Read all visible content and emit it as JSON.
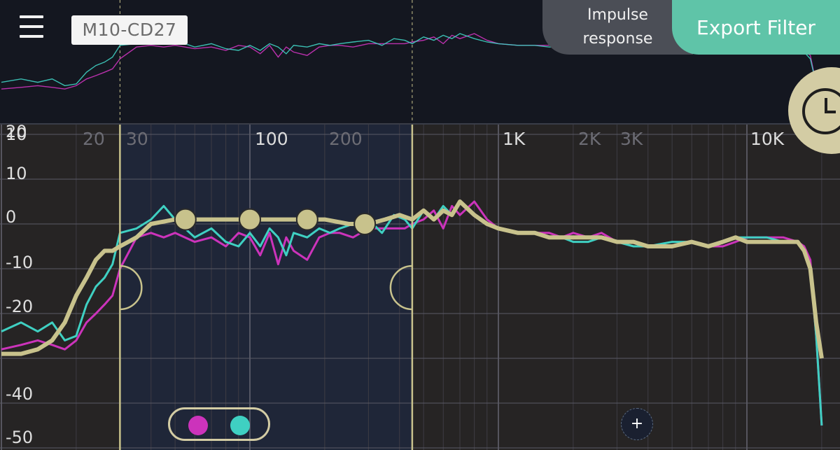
{
  "header": {
    "device_label": "M10-CD27",
    "tab_impulse": "Impulse\nresponse",
    "tab_impulse_line1": "Impulse",
    "tab_impulse_line2": "response",
    "tab_export": "Export Filter"
  },
  "colors": {
    "left_channel": "#cc33bb",
    "right_channel": "#3fd0c2",
    "target_curve": "#c8c28c",
    "selection_fill": "#1f2638",
    "accent": "#5fc4a8"
  },
  "icons": {
    "menu": "hamburger-icon",
    "history": "clock-icon",
    "add": "plus-icon"
  },
  "chart_data": {
    "type": "line",
    "xscale": "log",
    "xlim": [
      10,
      20000
    ],
    "ylim": [
      -50,
      20
    ],
    "x_tick_labels": [
      "20",
      "30",
      "100",
      "200",
      "1K",
      "2K",
      "3K",
      "10K"
    ],
    "y_tick_labels": [
      "20",
      "10",
      "10",
      "0",
      "-10",
      "-20",
      "-40",
      "-50"
    ],
    "selection_range_hz": [
      30,
      450
    ],
    "handles_hz": [
      30,
      450
    ],
    "series": [
      {
        "key": "left",
        "x": [
          10,
          12,
          14,
          16,
          18,
          20,
          22,
          24,
          26,
          28,
          30,
          35,
          40,
          45,
          50,
          60,
          70,
          80,
          90,
          100,
          110,
          120,
          130,
          140,
          150,
          170,
          190,
          210,
          230,
          260,
          300,
          340,
          380,
          420,
          450,
          500,
          550,
          600,
          650,
          700,
          800,
          900,
          1000,
          1200,
          1400,
          1600,
          1800,
          2000,
          2300,
          2600,
          3000,
          3500,
          4000,
          5000,
          6000,
          7000,
          8000,
          9000,
          10000,
          12000,
          14000,
          16000,
          17000,
          18000,
          19000,
          20000
        ],
        "y": [
          -28,
          -27,
          -26,
          -27,
          -28,
          -26,
          -22,
          -20,
          -18,
          -16,
          -10,
          -3,
          -2,
          -3,
          -2,
          -4,
          -3,
          -5,
          -2,
          -3,
          -7,
          -2,
          -9,
          -3,
          -6,
          -8,
          -3,
          -2,
          -2,
          -3,
          -1,
          -1,
          -1,
          -1,
          0,
          1,
          3,
          -1,
          4,
          2,
          5,
          1,
          -1,
          -2,
          -2,
          -2,
          -3,
          -2,
          -3,
          -2,
          -4,
          -4,
          -5,
          -5,
          -4,
          -5,
          -5,
          -4,
          -3,
          -3,
          -3,
          -4,
          -5,
          -8,
          -25,
          -45
        ]
      },
      {
        "key": "right",
        "x": [
          10,
          12,
          14,
          16,
          18,
          20,
          22,
          24,
          26,
          28,
          30,
          35,
          40,
          45,
          50,
          60,
          70,
          80,
          90,
          100,
          110,
          120,
          130,
          140,
          150,
          170,
          190,
          210,
          230,
          260,
          300,
          340,
          380,
          420,
          450,
          500,
          550,
          600,
          650,
          700,
          800,
          900,
          1000,
          1200,
          1400,
          1600,
          1800,
          2000,
          2300,
          2600,
          3000,
          3500,
          4000,
          5000,
          6000,
          7000,
          8000,
          9000,
          10000,
          12000,
          14000,
          16000,
          17000,
          18000,
          19000,
          20000
        ],
        "y": [
          -24,
          -22,
          -24,
          -22,
          -26,
          -25,
          -18,
          -14,
          -12,
          -9,
          -2,
          -1,
          1,
          4,
          1,
          -3,
          -1,
          -4,
          -5,
          -2,
          -5,
          -1,
          -3,
          -7,
          -2,
          -3,
          -1,
          -2,
          -1,
          0,
          1,
          -2,
          2,
          1,
          -1,
          3,
          1,
          4,
          2,
          5,
          2,
          0,
          -1,
          -2,
          -2,
          -3,
          -3,
          -4,
          -4,
          -3,
          -4,
          -5,
          -5,
          -4,
          -4,
          -5,
          -4,
          -3,
          -3,
          -3,
          -4,
          -4,
          -6,
          -10,
          -25,
          -45
        ]
      },
      {
        "key": "target",
        "x": [
          10,
          12,
          14,
          16,
          18,
          20,
          22,
          24,
          26,
          28,
          30,
          35,
          40,
          50,
          60,
          80,
          100,
          130,
          160,
          200,
          250,
          300,
          350,
          400,
          450,
          500,
          550,
          600,
          650,
          700,
          800,
          900,
          1000,
          1200,
          1400,
          1600,
          1800,
          2000,
          2300,
          2600,
          3000,
          3500,
          4000,
          5000,
          6000,
          7000,
          8000,
          9000,
          10000,
          12000,
          14000,
          16000,
          17000,
          18000,
          19000,
          20000
        ],
        "y": [
          -29,
          -29,
          -28,
          -26,
          -22,
          -16,
          -12,
          -8,
          -6,
          -6,
          -5,
          -3,
          0,
          1,
          1,
          1,
          1,
          1,
          1,
          1,
          0,
          0,
          1,
          2,
          1,
          3,
          1,
          3,
          2,
          5,
          2,
          0,
          -1,
          -2,
          -2,
          -3,
          -3,
          -3,
          -3,
          -3,
          -4,
          -4,
          -5,
          -5,
          -4,
          -5,
          -4,
          -3,
          -4,
          -4,
          -4,
          -4,
          -6,
          -10,
          -22,
          -30
        ]
      }
    ],
    "control_points_hz": [
      55,
      100,
      170,
      290
    ]
  }
}
